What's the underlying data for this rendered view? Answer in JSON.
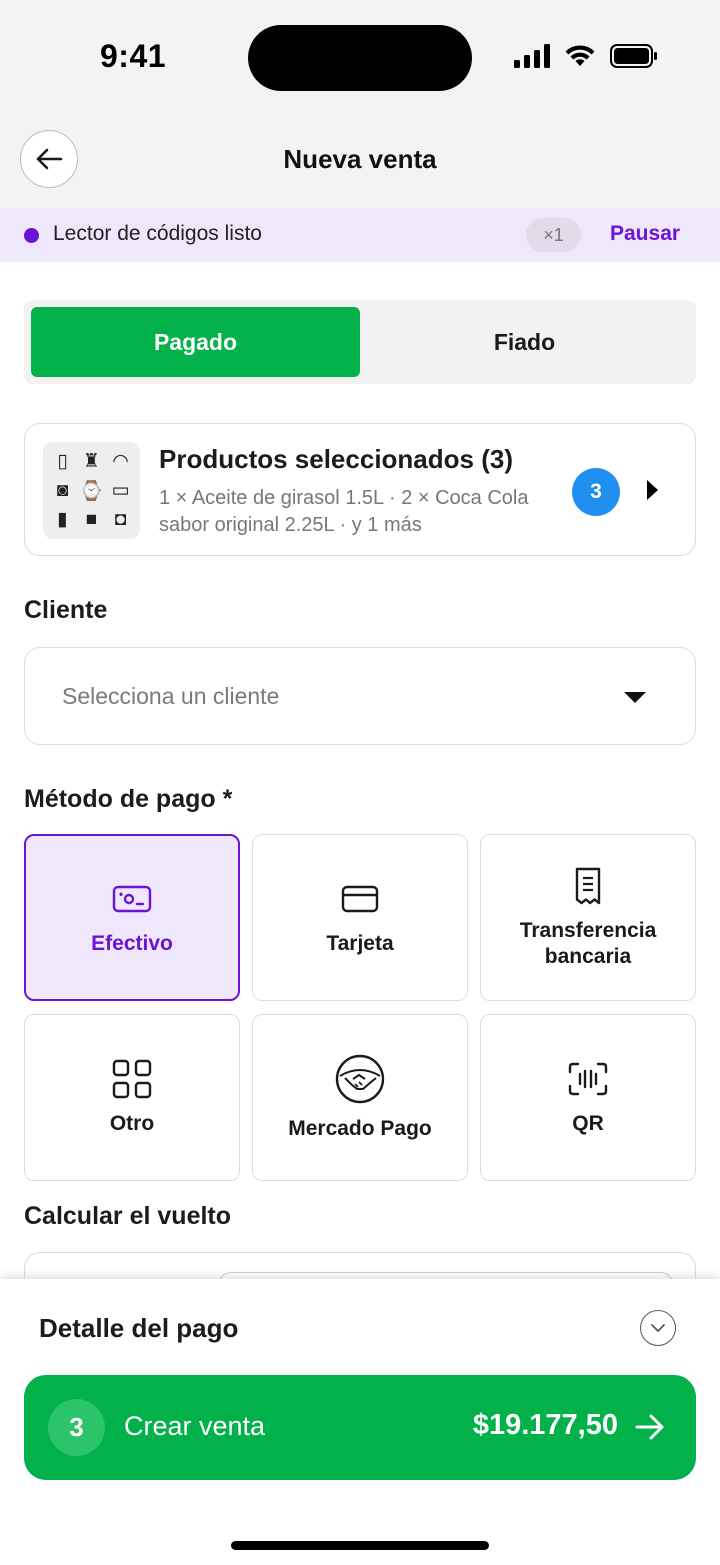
{
  "status_bar": {
    "time": "9:41"
  },
  "header": {
    "title": "Nueva venta",
    "back_icon": "arrow-left-icon"
  },
  "scanner": {
    "text": "Lector de códigos listo",
    "count": "×1",
    "action": "Pausar",
    "accent": "#6b14d6"
  },
  "payment_status": {
    "options": [
      "Pagado",
      "Fiado"
    ],
    "selected": "Pagado",
    "accent": "#03b14a"
  },
  "products": {
    "title": "Productos seleccionados (3)",
    "description": "1 × Aceite de girasol 1.5L · 2 × Coca Cola sabor original 2.25L · y 1 más",
    "badge": "3"
  },
  "client": {
    "label": "Cliente",
    "placeholder": "Selecciona un cliente"
  },
  "payment_method": {
    "label": "Método de pago *",
    "selected": "Efectivo",
    "options": [
      {
        "label": "Efectivo",
        "icon": "cash-icon"
      },
      {
        "label": "Tarjeta",
        "icon": "card-icon"
      },
      {
        "label": "Transferencia bancaria",
        "icon": "receipt-icon"
      },
      {
        "label": "Otro",
        "icon": "grid-icon"
      },
      {
        "label": "Mercado Pago",
        "icon": "handshake-icon"
      },
      {
        "label": "QR",
        "icon": "qr-scan-icon"
      }
    ]
  },
  "change": {
    "label": "Calcular el vuelto"
  },
  "summary": {
    "title": "Detalle del pago",
    "cta_count": "3",
    "cta_label": "Crear venta",
    "cta_total": "$19.177,50"
  }
}
